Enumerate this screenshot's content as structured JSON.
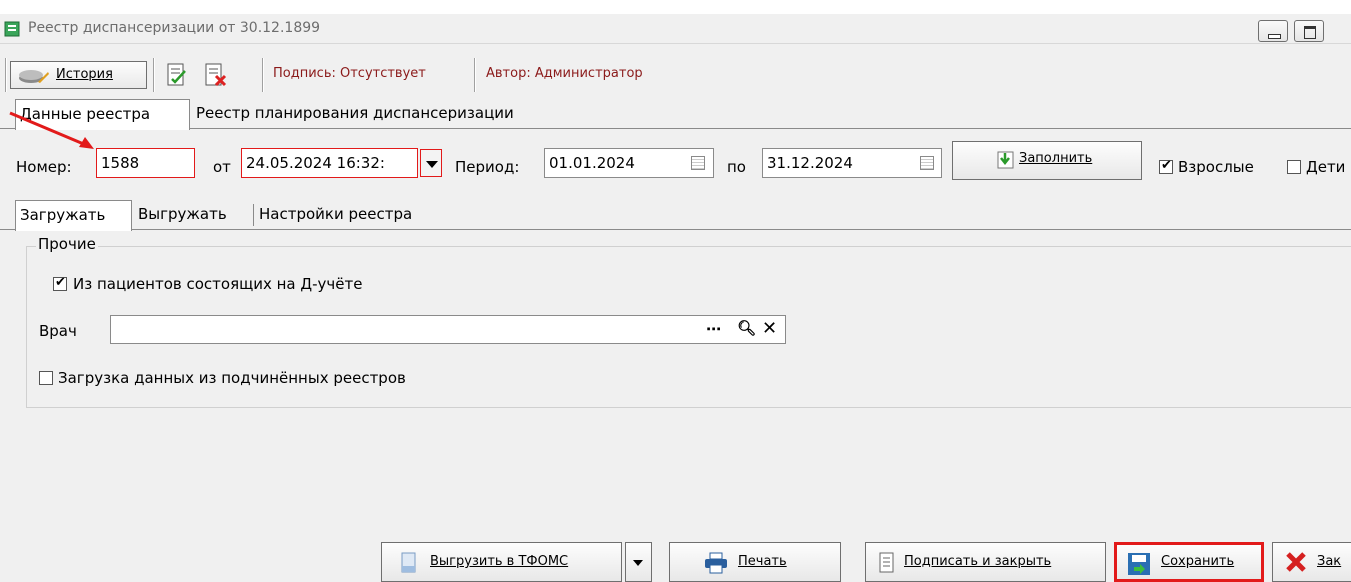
{
  "window": {
    "title": "Реестр диспансеризации  от 30.12.1899"
  },
  "toolbar": {
    "history_label": "История",
    "signature": "Подпись: Отсутствует",
    "author": "Автор: Администратор"
  },
  "main_tabs": [
    {
      "label": "Данные реестра",
      "active": true
    },
    {
      "label": "Реестр планирования диспансеризации",
      "active": false
    }
  ],
  "params": {
    "number_label": "Номер:",
    "number_value": "1588",
    "from_label": "от",
    "date_value": "24.05.2024 16:32:",
    "period_label": "Период:",
    "period_from": "01.01.2024",
    "to_label": "по",
    "period_to": "31.12.2024",
    "fill_label": "Заполнить",
    "adults_label": "Взрослые",
    "adults_checked": true,
    "children_label": "Дети",
    "children_checked": false
  },
  "inner_tabs": [
    {
      "label": "Загружать",
      "active": true
    },
    {
      "label": "Выгружать",
      "active": false
    },
    {
      "label": "Настройки реестра",
      "active": false
    }
  ],
  "other_group": {
    "title": "Прочие",
    "from_patients_label": "Из пациентов состоящих на Д-учёте",
    "from_patients_checked": true,
    "doctor_label": "Врач",
    "doctor_value": "",
    "subordinate_label": "Загрузка данных из подчинённых реестров",
    "subordinate_checked": false
  },
  "bottom": {
    "export_label": "Выгрузить в ТФОМС",
    "print_label": "Печать",
    "sign_close_label": "Подписать и закрыть",
    "save_label": "Сохранить",
    "close_label": "Зак"
  },
  "colors": {
    "highlight": "#e21a1a",
    "signature_text": "#8b1a1a"
  }
}
